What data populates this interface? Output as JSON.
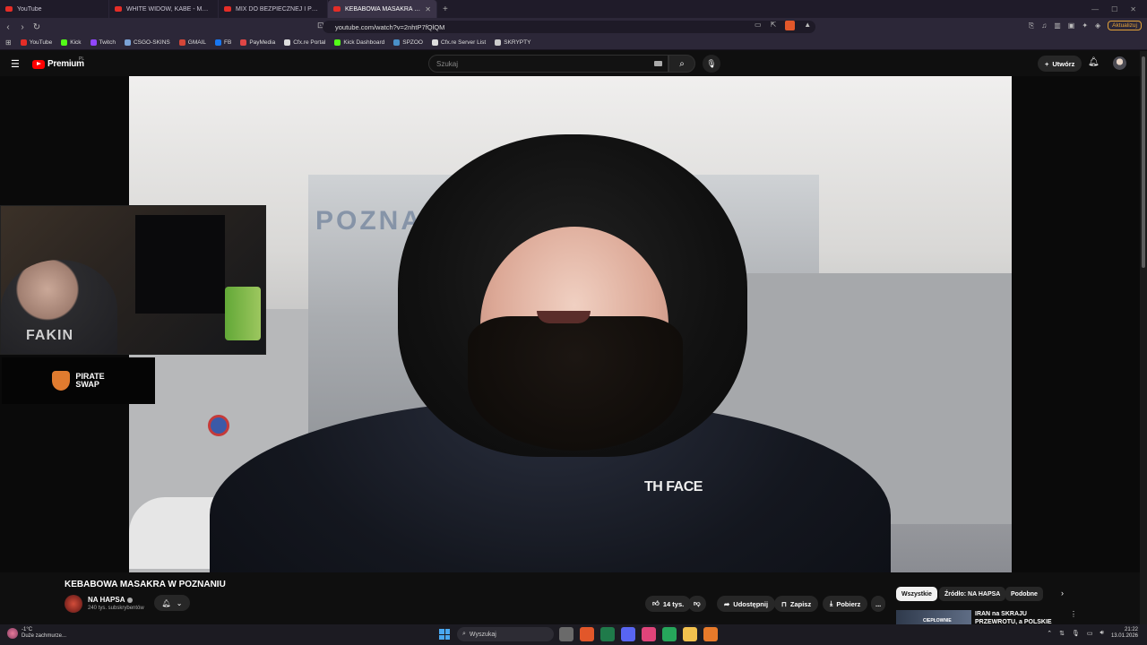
{
  "browser": {
    "tabs": [
      {
        "title": "YouTube",
        "active": false
      },
      {
        "title": "WHITE WIDOW, KABE - MUSZĘ GRA...",
        "active": false
      },
      {
        "title": "MIX DO BEZPIECZNEJ I PRZEPISOWEJ...",
        "active": false
      },
      {
        "title": "KEBABOWA MASAKRA W PO...",
        "active": true
      }
    ],
    "new_tab": "+",
    "url": "youtube.com/watch?v=2nhtP7fQlQM",
    "update_label": "Aktualizuj",
    "brave_badge": "8",
    "bookmarks": [
      {
        "label": "YouTube",
        "color": "#e52d27"
      },
      {
        "label": "Kick",
        "color": "#53fc18"
      },
      {
        "label": "Twitch",
        "color": "#9146ff"
      },
      {
        "label": "CSGO-SKINS",
        "color": "#7aa2d6"
      },
      {
        "label": "GMAIL",
        "color": "#d44638"
      },
      {
        "label": "FB",
        "color": "#1877f2"
      },
      {
        "label": "PayMedia",
        "color": "#e04646"
      },
      {
        "label": "Cfx.re Portal",
        "color": "#dddddd"
      },
      {
        "label": "Kick Dashboard",
        "color": "#53fc18"
      },
      {
        "label": "SPZOO",
        "color": "#4a90c8"
      },
      {
        "label": "Cfx.re Server List",
        "color": "#dddddd"
      },
      {
        "label": "SKRYPTY",
        "color": "#cccccc"
      }
    ]
  },
  "youtube": {
    "logo_word": "Premium",
    "region": "PL",
    "search_placeholder": "Szukaj",
    "create_label": "Utwórz"
  },
  "video": {
    "title": "KEBABOWA MASAKRA W POZNANIU",
    "scene_sign": "POZNA",
    "jacket_logo": "TH FACE",
    "webcam_text": "FAKIN",
    "sponsor": {
      "line1": "PIRATE",
      "line2": "SWAP"
    },
    "channel_name": "NA HAPSA",
    "subscribers": "240 tys. subskrybentów",
    "likes": "14 tys.",
    "share_label": "Udostępnij",
    "save_label": "Zapisz",
    "download_label": "Pobierz",
    "more_label": "..."
  },
  "chips": [
    {
      "label": "Wszystkie",
      "selected": true
    },
    {
      "label": "Źródło: NA HAPSA",
      "selected": false
    },
    {
      "label": "Podobne",
      "selected": false
    }
  ],
  "recommendation": {
    "title": "IRAN na SKRAJU PRZEWROTU, a POLSKIE CIEPŁOWNIE...",
    "thumb_text": "CIEPŁOWNIE"
  },
  "taskbar": {
    "temperature": "-1°C",
    "weather": "Duże zachmurze...",
    "search_label": "Wyszukaj",
    "time": "21:22",
    "date": "13.01.2026",
    "apps_colors": [
      "#6a6a6a",
      "#e2572a",
      "#1f7a4a",
      "#5865f2",
      "#e0447a",
      "#26a65b",
      "#f2c14e",
      "#e87a2a"
    ]
  }
}
